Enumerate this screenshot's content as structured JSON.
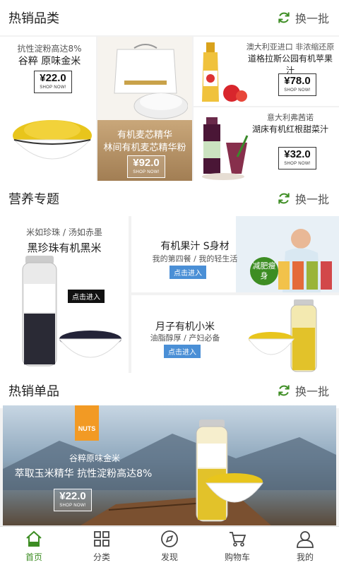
{
  "hot_category": {
    "title": "热销品类",
    "refresh_label": "换一批",
    "items": [
      {
        "line1": "抗性淀粉高达8%",
        "line2": "谷粹 原味金米",
        "price": "22.0"
      },
      {
        "line1": "有机麦芯精华",
        "line2": "林间有机麦芯精华粉",
        "price": "92.0"
      },
      {
        "line1": "澳大利亚进口 非浓缩还原",
        "line2": "道格拉斯公园有机苹果汁",
        "price": "78.0"
      },
      {
        "line1": "意大利弗茜诺",
        "line2": "湖床有机红根甜菜汁",
        "price": "32.0"
      }
    ],
    "shop_now": "SHOP NOW!",
    "yen": "¥"
  },
  "nutrition": {
    "title": "营养专题",
    "refresh_label": "换一批",
    "left": {
      "line1": "米如珍珠 / 汤如赤墨",
      "line2": "黑珍珠有机黑米",
      "enter": "点击进入"
    },
    "right_top": {
      "title": "有机果汁 S身材",
      "subtitle": "我的第四餐 / 我的轻生活",
      "enter": "点击进入",
      "badge": "减肥瘦身"
    },
    "right_bottom": {
      "title": "月子有机小米",
      "subtitle": "油脂醇厚 / 产妇必备",
      "enter": "点击进入"
    }
  },
  "hot_single": {
    "title": "热销单品",
    "refresh_label": "换一批",
    "banner": {
      "tag": "NUTS",
      "line1": "谷粹原味金米",
      "line2": "萃取玉米精华 抗性淀粉高达8%",
      "price": "22.0",
      "shop_now": "SHOP NOW!",
      "yen": "¥"
    }
  },
  "tabbar": [
    {
      "label": "首页",
      "icon": "home-icon",
      "active": true
    },
    {
      "label": "分类",
      "icon": "grid-icon",
      "active": false
    },
    {
      "label": "发现",
      "icon": "compass-icon",
      "active": false
    },
    {
      "label": "购物车",
      "icon": "cart-icon",
      "active": false
    },
    {
      "label": "我的",
      "icon": "user-icon",
      "active": false
    }
  ],
  "colors": {
    "accent_green": "#3d8d23",
    "enter_blue": "#4a8fd6",
    "banner_orange": "#f29a24"
  }
}
